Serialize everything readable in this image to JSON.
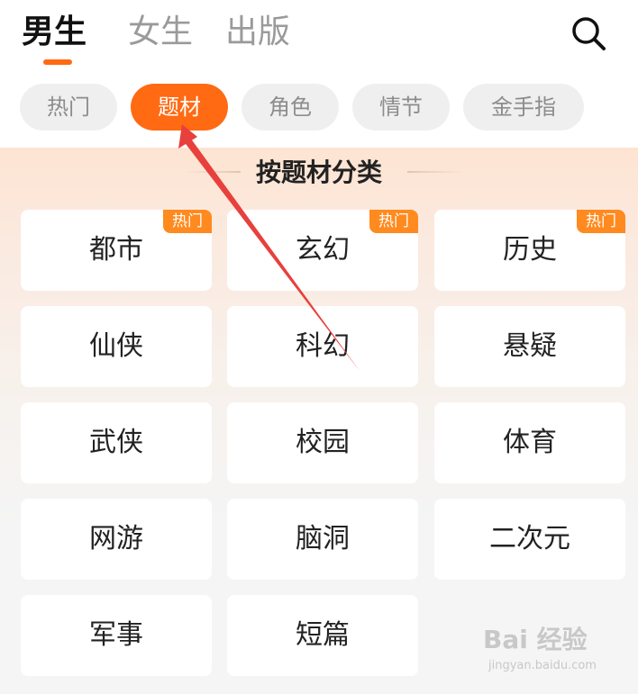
{
  "header": {
    "tabs": [
      {
        "label": "男生",
        "active": true
      },
      {
        "label": "女生",
        "active": false
      },
      {
        "label": "出版",
        "active": false
      }
    ],
    "search_icon": "search-icon"
  },
  "filters": [
    {
      "label": "热门",
      "active": false
    },
    {
      "label": "题材",
      "active": true
    },
    {
      "label": "角色",
      "active": false
    },
    {
      "label": "情节",
      "active": false
    },
    {
      "label": "金手指",
      "active": false
    }
  ],
  "section": {
    "title": "按题材分类"
  },
  "categories": [
    {
      "label": "都市",
      "badge": "热门"
    },
    {
      "label": "玄幻",
      "badge": "热门"
    },
    {
      "label": "历史",
      "badge": "热门"
    },
    {
      "label": "仙侠"
    },
    {
      "label": "科幻"
    },
    {
      "label": "悬疑"
    },
    {
      "label": "武侠"
    },
    {
      "label": "校园"
    },
    {
      "label": "体育"
    },
    {
      "label": "网游"
    },
    {
      "label": "脑洞"
    },
    {
      "label": "二次元"
    },
    {
      "label": "军事"
    },
    {
      "label": "短篇"
    }
  ],
  "watermark": {
    "logo": "Bai 经验",
    "url": "jingyan.baidu.com"
  },
  "colors": {
    "accent": "#ff6a13",
    "badge": "#ff8a1f",
    "arrow": "#e8403c"
  }
}
